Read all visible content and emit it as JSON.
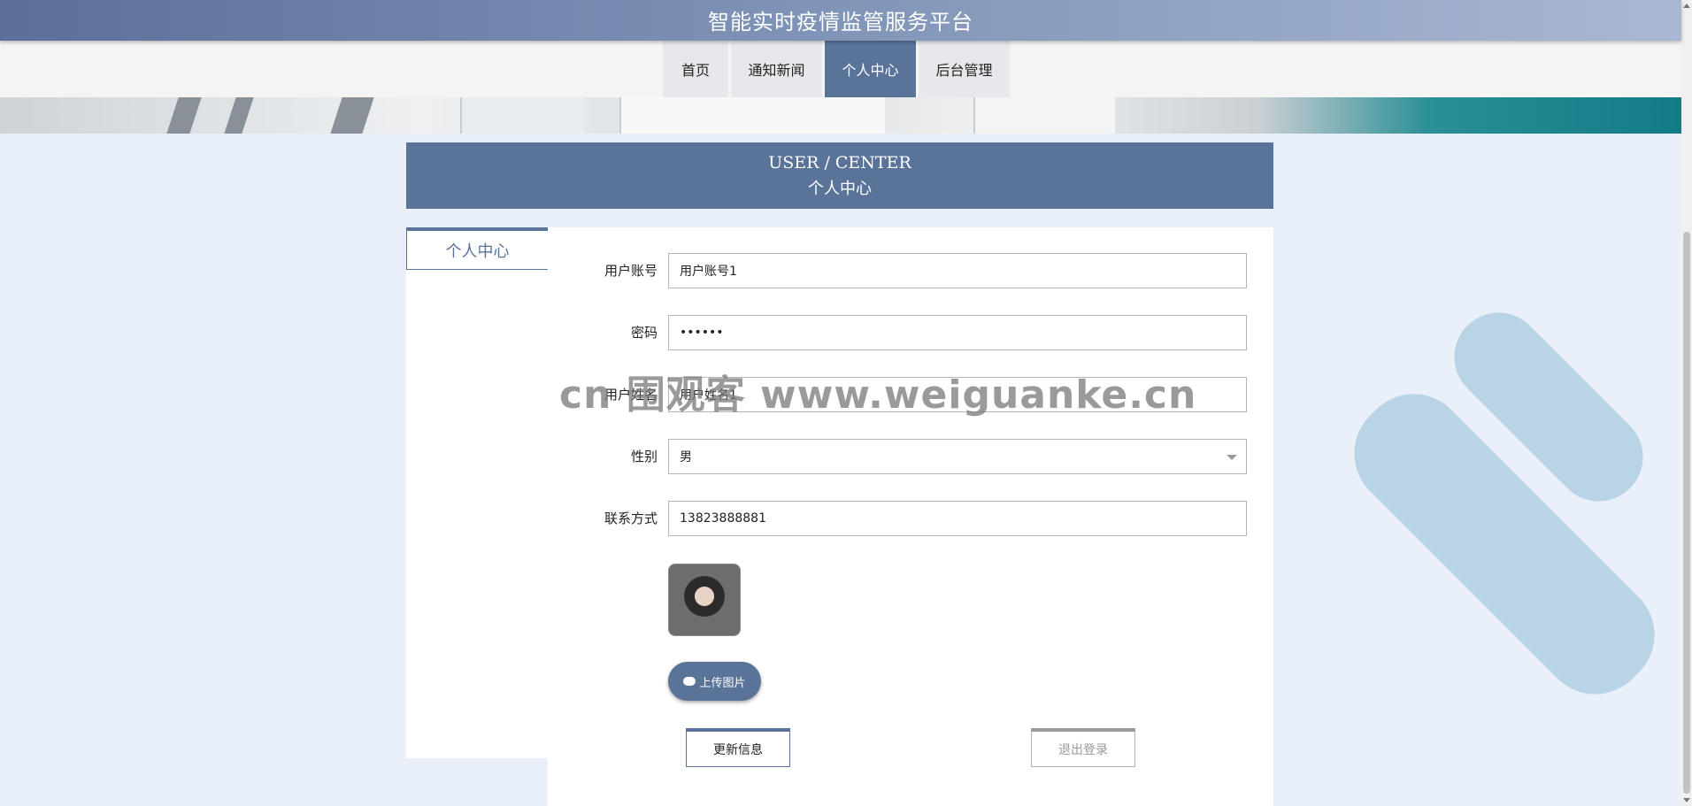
{
  "app": {
    "title": "智能实时疫情监管服务平台"
  },
  "nav": {
    "items": [
      {
        "label": "首页",
        "active": false
      },
      {
        "label": "通知新闻",
        "active": false
      },
      {
        "label": "个人中心",
        "active": true
      },
      {
        "label": "后台管理",
        "active": false
      }
    ]
  },
  "header": {
    "en": "USER / CENTER",
    "cn": "个人中心"
  },
  "sidebar": {
    "tab_label": "个人中心"
  },
  "form": {
    "fields": [
      {
        "label": "用户账号",
        "value": "用户账号1"
      },
      {
        "label": "密码",
        "value": "••••••"
      },
      {
        "label": "用户姓名",
        "value": "用户姓名1"
      },
      {
        "label": "性别",
        "value": "男"
      },
      {
        "label": "联系方式",
        "value": "13823888881"
      }
    ],
    "upload_label": "上传图片",
    "update_label": "更新信息",
    "logout_label": "退出登录"
  },
  "watermark": "cn 围观客 www.weiguanke.cn",
  "colors": {
    "accent": "#5a7399",
    "deco": "#b9d4e6",
    "background": "#eaf0fa"
  }
}
